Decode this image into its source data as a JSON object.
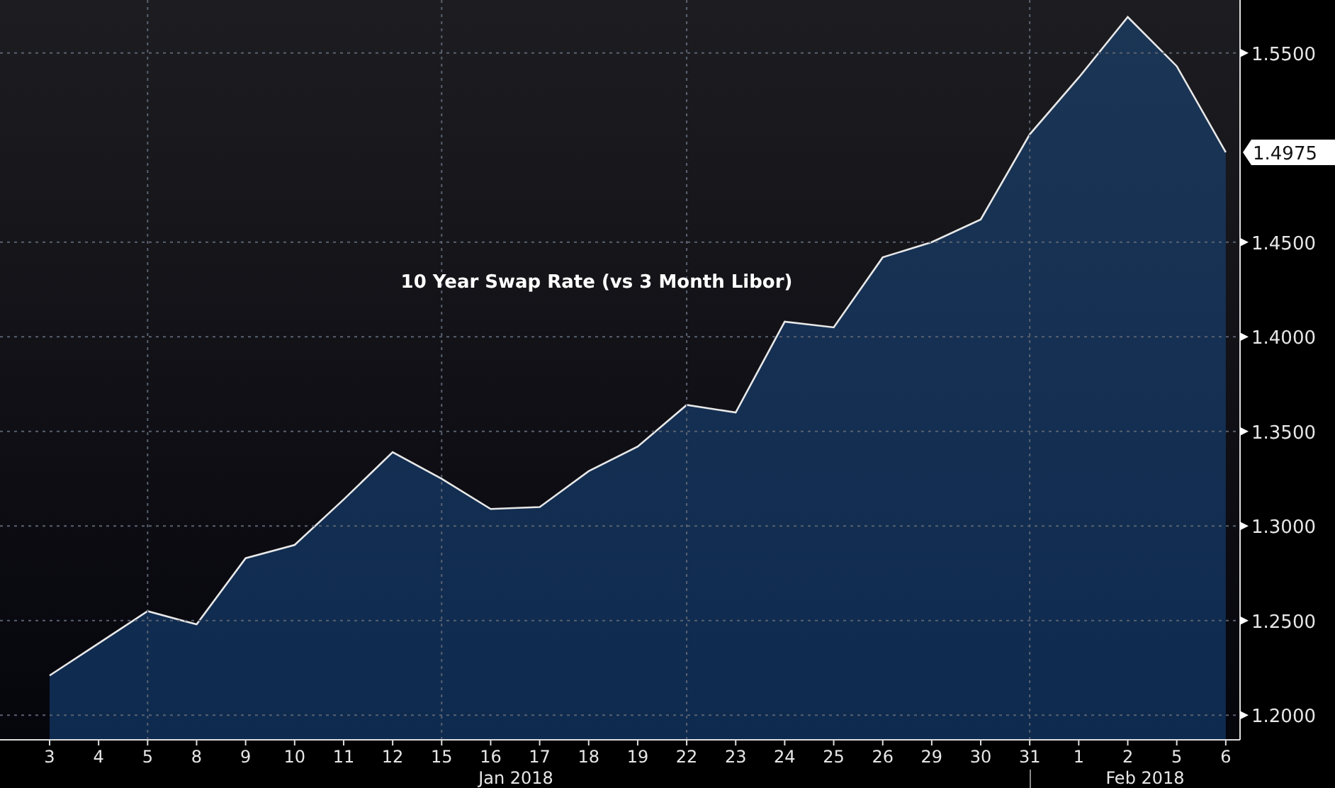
{
  "chart": {
    "chart_data": {
      "type": "area",
      "title": "10 Year Swap Rate (vs 3 Month Libor)",
      "categories": [
        "3",
        "4",
        "5",
        "8",
        "9",
        "10",
        "11",
        "12",
        "15",
        "16",
        "17",
        "18",
        "19",
        "22",
        "23",
        "24",
        "25",
        "26",
        "29",
        "30",
        "31",
        "1",
        "2",
        "5",
        "6"
      ],
      "series": [
        {
          "color": "#0e2a4f",
          "values": [
            1.221,
            1.238,
            1.255,
            1.248,
            1.283,
            1.29,
            1.314,
            1.339,
            1.325,
            1.309,
            1.31,
            1.329,
            1.342,
            1.364,
            1.36,
            1.408,
            1.405,
            1.442,
            1.45,
            1.462,
            1.507,
            1.537,
            1.569,
            1.543,
            1.4975
          ]
        }
      ],
      "yticks": [
        {
          "value": 1.2,
          "label": "1.2000"
        },
        {
          "value": 1.25,
          "label": "1.2500"
        },
        {
          "value": 1.3,
          "label": "1.3000"
        },
        {
          "value": 1.35,
          "label": "1.3500"
        },
        {
          "value": 1.4,
          "label": "1.4000"
        },
        {
          "value": 1.45,
          "label": "1.4500"
        },
        {
          "value": 1.55,
          "label": "1.5500"
        }
      ],
      "ylim": [
        1.187,
        1.578
      ],
      "grid": true,
      "annotations": [
        "1.4975"
      ]
    },
    "months": [
      {
        "label": "Jan 2018"
      },
      {
        "label": "Feb 2018"
      }
    ]
  }
}
